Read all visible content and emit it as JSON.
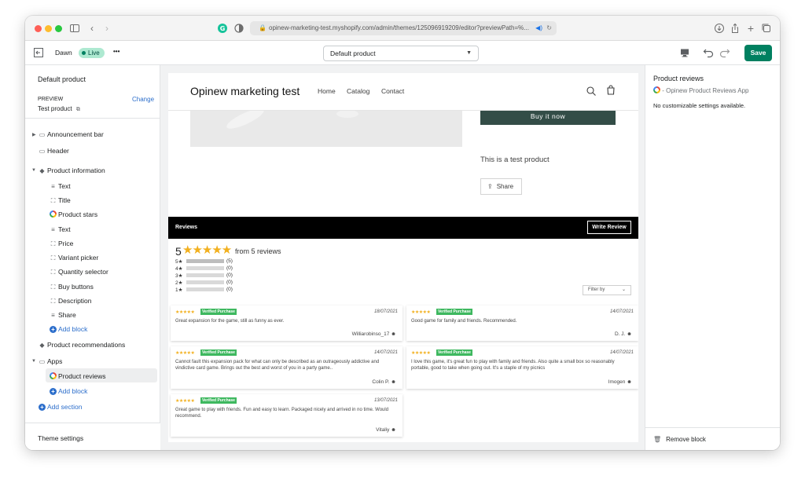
{
  "browser": {
    "url": "opinew-marketing-test.myshopify.com/admin/themes/125096919209/editor?previewPath=%..."
  },
  "editor": {
    "theme_name": "Dawn",
    "status_badge": "Live",
    "more_label": "•••",
    "template_select": "Default product",
    "save_label": "Save"
  },
  "sidebar": {
    "page_title": "Default product",
    "preview_label": "PREVIEW",
    "preview_change": "Change",
    "preview_value": "Test product",
    "items": [
      {
        "label": "Announcement bar",
        "icon": "layout-section-icon"
      },
      {
        "label": "Header",
        "icon": "layout-section-icon"
      },
      {
        "label": "Product information",
        "icon": "tag-icon"
      },
      {
        "label": "Text",
        "icon": "text-icon"
      },
      {
        "label": "Title",
        "icon": "block-icon"
      },
      {
        "label": "Product stars",
        "icon": "opinew-app-icon"
      },
      {
        "label": "Text",
        "icon": "text-icon"
      },
      {
        "label": "Price",
        "icon": "block-icon"
      },
      {
        "label": "Variant picker",
        "icon": "block-icon"
      },
      {
        "label": "Quantity selector",
        "icon": "block-icon"
      },
      {
        "label": "Buy buttons",
        "icon": "block-icon"
      },
      {
        "label": "Description",
        "icon": "block-icon"
      },
      {
        "label": "Share",
        "icon": "text-icon"
      },
      {
        "label": "Add block",
        "icon": "plus-circle-icon"
      },
      {
        "label": "Product recommendations",
        "icon": "tag-icon"
      },
      {
        "label": "Apps",
        "icon": "layout-section-icon"
      },
      {
        "label": "Product reviews",
        "icon": "opinew-app-icon"
      },
      {
        "label": "Add block",
        "icon": "plus-circle-icon"
      },
      {
        "label": "Add section",
        "icon": "plus-circle-icon"
      }
    ],
    "theme_settings": "Theme settings"
  },
  "store": {
    "title": "Opinew marketing test",
    "nav": [
      "Home",
      "Catalog",
      "Contact"
    ],
    "buy_now": "Buy it now",
    "description": "This is a test product",
    "share": "Share"
  },
  "reviews": {
    "heading": "Reviews",
    "write_review": "Write Review",
    "average": "5",
    "stars": "★★★★★",
    "summary": "from 5 reviews",
    "histogram": [
      {
        "label": "5★",
        "count": "(5)",
        "fraction": 1.0
      },
      {
        "label": "4★",
        "count": "(0)",
        "fraction": 0
      },
      {
        "label": "3★",
        "count": "(0)",
        "fraction": 0
      },
      {
        "label": "2★",
        "count": "(0)",
        "fraction": 0
      },
      {
        "label": "1★",
        "count": "(0)",
        "fraction": 0
      }
    ],
    "filter_label": "Filter by",
    "badge": "Verified Purchase",
    "items": [
      {
        "stars": "★★★★★",
        "date": "18/07/2021",
        "text": "Great expansion for the game, still as funny as ever.",
        "author": "Williarobinso_17"
      },
      {
        "stars": "★★★★★",
        "date": "14/07/2021",
        "text": "Good game for family and friends. Recommended.",
        "author": "D. J."
      },
      {
        "stars": "★★★★★",
        "date": "14/07/2021",
        "text": "Cannot fault this expansion pack for what can only be described as an outrageously addictive and vindictive card game. Brings out the best and worst of you in a party game..",
        "author": "Colin P."
      },
      {
        "stars": "★★★★★",
        "date": "14/07/2021",
        "text": "I love this game, it's great fun to play with family and friends. Also quite a small box so reasonably portable, good to take when going out. It's a staple of my picnics",
        "author": "Imogen"
      },
      {
        "stars": "★★★★★",
        "date": "13/07/2021",
        "text": "Great game to play with friends. Fun and easy to learn. Packaged nicely and arrived in no time. Would recommend.",
        "author": "Vitaliy"
      }
    ]
  },
  "inspector": {
    "title": "Product reviews",
    "app_name": "- Opinew Product Reviews App",
    "note": "No customizable settings available.",
    "remove": "Remove block"
  },
  "colors": {
    "shopify_green": "#008060",
    "star": "#f2b01e",
    "verified": "#3eb85f",
    "link": "#2c6ecb"
  }
}
